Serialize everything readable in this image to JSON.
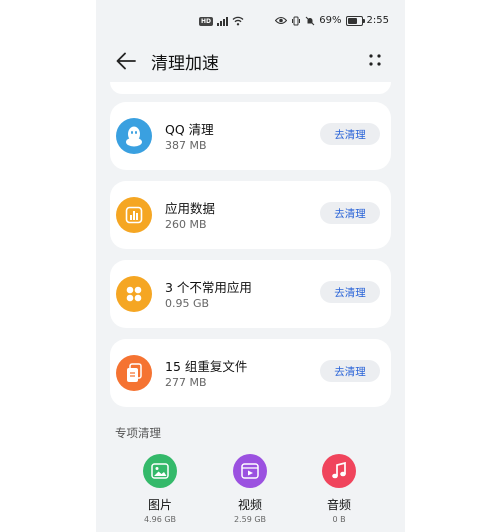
{
  "status_bar": {
    "hd_label": "HD",
    "battery": "69%",
    "battery_level": 0.69,
    "time": "2:55"
  },
  "header": {
    "title": "清理加速"
  },
  "cards": [
    {
      "title": "QQ 清理",
      "size": "387 MB",
      "button": "去清理",
      "icon": "qq-penguin-icon",
      "color": "#3aa0e0"
    },
    {
      "title": "应用数据",
      "size": "260 MB",
      "button": "去清理",
      "icon": "bar-chart-icon",
      "color": "#f5a623"
    },
    {
      "title": "3 个不常用应用",
      "size": "0.95 GB",
      "button": "去清理",
      "icon": "app-grid-icon",
      "color": "#f5a623"
    },
    {
      "title": "15 组重复文件",
      "size": "277 MB",
      "button": "去清理",
      "icon": "duplicate-file-icon",
      "color": "#f57332"
    }
  ],
  "special": {
    "title": "专项清理",
    "items": [
      {
        "label": "图片",
        "size": "4.96 GB",
        "icon": "image-icon",
        "color": "#34b96a"
      },
      {
        "label": "视频",
        "size": "2.59 GB",
        "icon": "video-icon",
        "color": "#9b51e0"
      },
      {
        "label": "音频",
        "size": "0 B",
        "icon": "music-note-icon",
        "color": "#f0445c"
      }
    ]
  }
}
